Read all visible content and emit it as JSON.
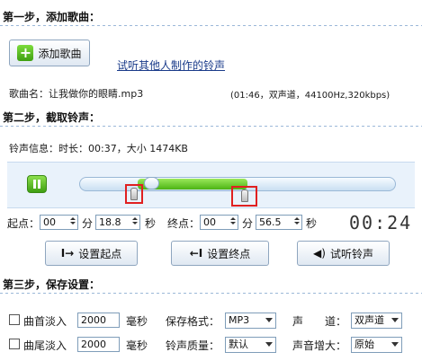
{
  "step1": {
    "title": "第一步，添加歌曲：",
    "add_button": "添加歌曲",
    "listen_link": "试听其他人制作的铃声",
    "song_label": "歌曲名：让我做你的眼睛.mp3",
    "song_info": "(01:46，双声道，44100Hz,320kbps)"
  },
  "step2": {
    "title": "第二步，截取铃声：",
    "ringtone_info": "铃声信息：时长：00:37，大小 1474KB",
    "progress_fraction": 0.35,
    "start": {
      "label": "起点：",
      "min": "00",
      "min_unit": "分",
      "sec": "18.8",
      "sec_unit": "秒"
    },
    "end": {
      "label": "终点：",
      "min": "00",
      "min_unit": "分",
      "sec": "56.5",
      "sec_unit": "秒"
    },
    "timer": "00:24",
    "buttons": {
      "set_start": "设置起点",
      "set_end": "设置终点",
      "preview": "试听铃声"
    }
  },
  "step3": {
    "title": "第三步，保存设置：",
    "fade_in": {
      "label": "曲首淡入",
      "value": "2000",
      "unit": "毫秒"
    },
    "fade_out": {
      "label": "曲尾淡入",
      "value": "2000",
      "unit": "毫秒"
    },
    "format": {
      "label": "保存格式：",
      "value": "MP3"
    },
    "quality": {
      "label": "铃声质量：",
      "value": "默认"
    },
    "channel": {
      "label": "声　　道：",
      "value": "双声道"
    },
    "volume": {
      "label": "声音增大：",
      "value": "原始"
    }
  },
  "colors": {
    "accent_green": "#5cc21a",
    "highlight_red": "#e02020",
    "panel_bg": "#e9f2fb"
  }
}
